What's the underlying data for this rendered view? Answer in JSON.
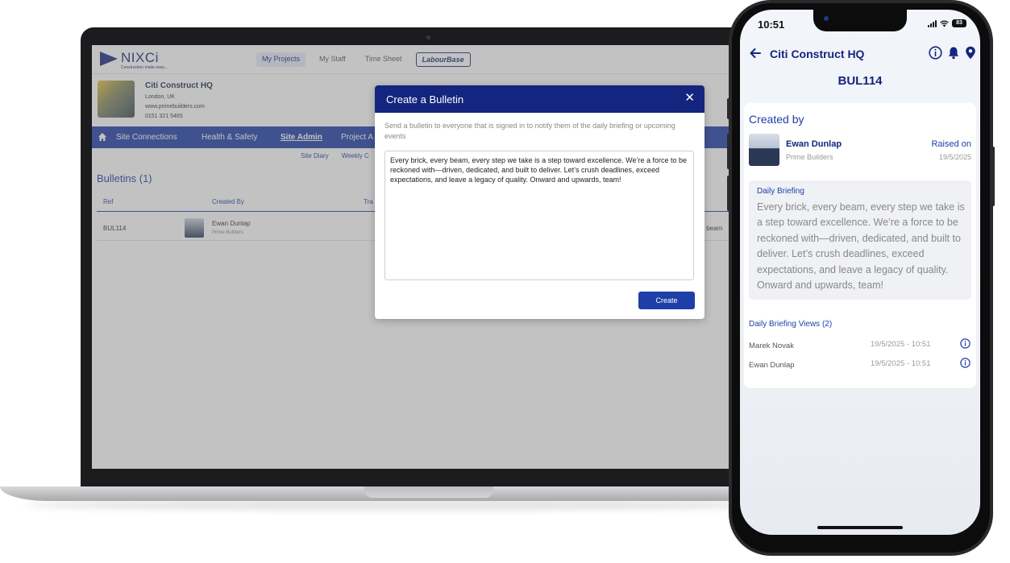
{
  "laptop_app": {
    "logo_text": "NIXCi",
    "logo_tagline": "Construction made easy...",
    "nav": [
      "My Projects",
      "My Staff",
      "Time Sheet",
      "LabourBase"
    ],
    "site": {
      "name": "Citi Construct HQ",
      "location": "London, UK",
      "website": "www.primebuilders.com",
      "phone": "0151 321 5465"
    },
    "tabs": [
      "Site Connections",
      "Health & Safety",
      "Site Admin",
      "Project A"
    ],
    "subtabs": [
      "Site Diary",
      "Weekly C"
    ],
    "bulletins_title": "Bulletins (1)",
    "columns": [
      "Ref",
      "Created By",
      "Tra"
    ],
    "row": {
      "ref": "BUL114",
      "name": "Ewan Dunlap",
      "company": "Prime Builders",
      "trunc": "y beam"
    }
  },
  "modal": {
    "title": "Create a Bulletin",
    "close_label": "✕",
    "description": "Send a bulletin to everyone that is signed in to notify them of the daily briefing or upcoming events",
    "message": "Every brick, every beam, every step we take is a step toward excellence. We’re a force to be reckoned with—driven, dedicated, and built to deliver. Let’s crush deadlines, exceed expectations, and leave a legacy of quality. Onward and upwards, team!",
    "create_label": "Create"
  },
  "phone": {
    "time": "10:51",
    "battery": "83",
    "title": "Citi Construct HQ",
    "ref": "BUL114",
    "created_by_label": "Created by",
    "creator_name": "Ewan Dunlap",
    "creator_company": "Prime Builders",
    "raised_label": "Raised on",
    "raised_date": "19/5/2025",
    "briefing_label": "Daily Briefing",
    "briefing_text": "Every brick, every beam, every step we take is a step toward excellence. We’re a force to be reckoned with—driven, dedicated, and built to deliver. Let’s crush deadlines, exceed expectations, and leave a legacy of quality. Onward and upwards, team!",
    "views_label": "Daily Briefing Views (2)",
    "views": [
      {
        "name": "Marek Novak",
        "time": "19/5/2025 - 10:51"
      },
      {
        "name": "Ewan Dunlap",
        "time": "19/5/2025 - 10:51"
      }
    ]
  },
  "colors": {
    "brand_navy": "#13257e",
    "brand_blue": "#1e3fa8"
  }
}
